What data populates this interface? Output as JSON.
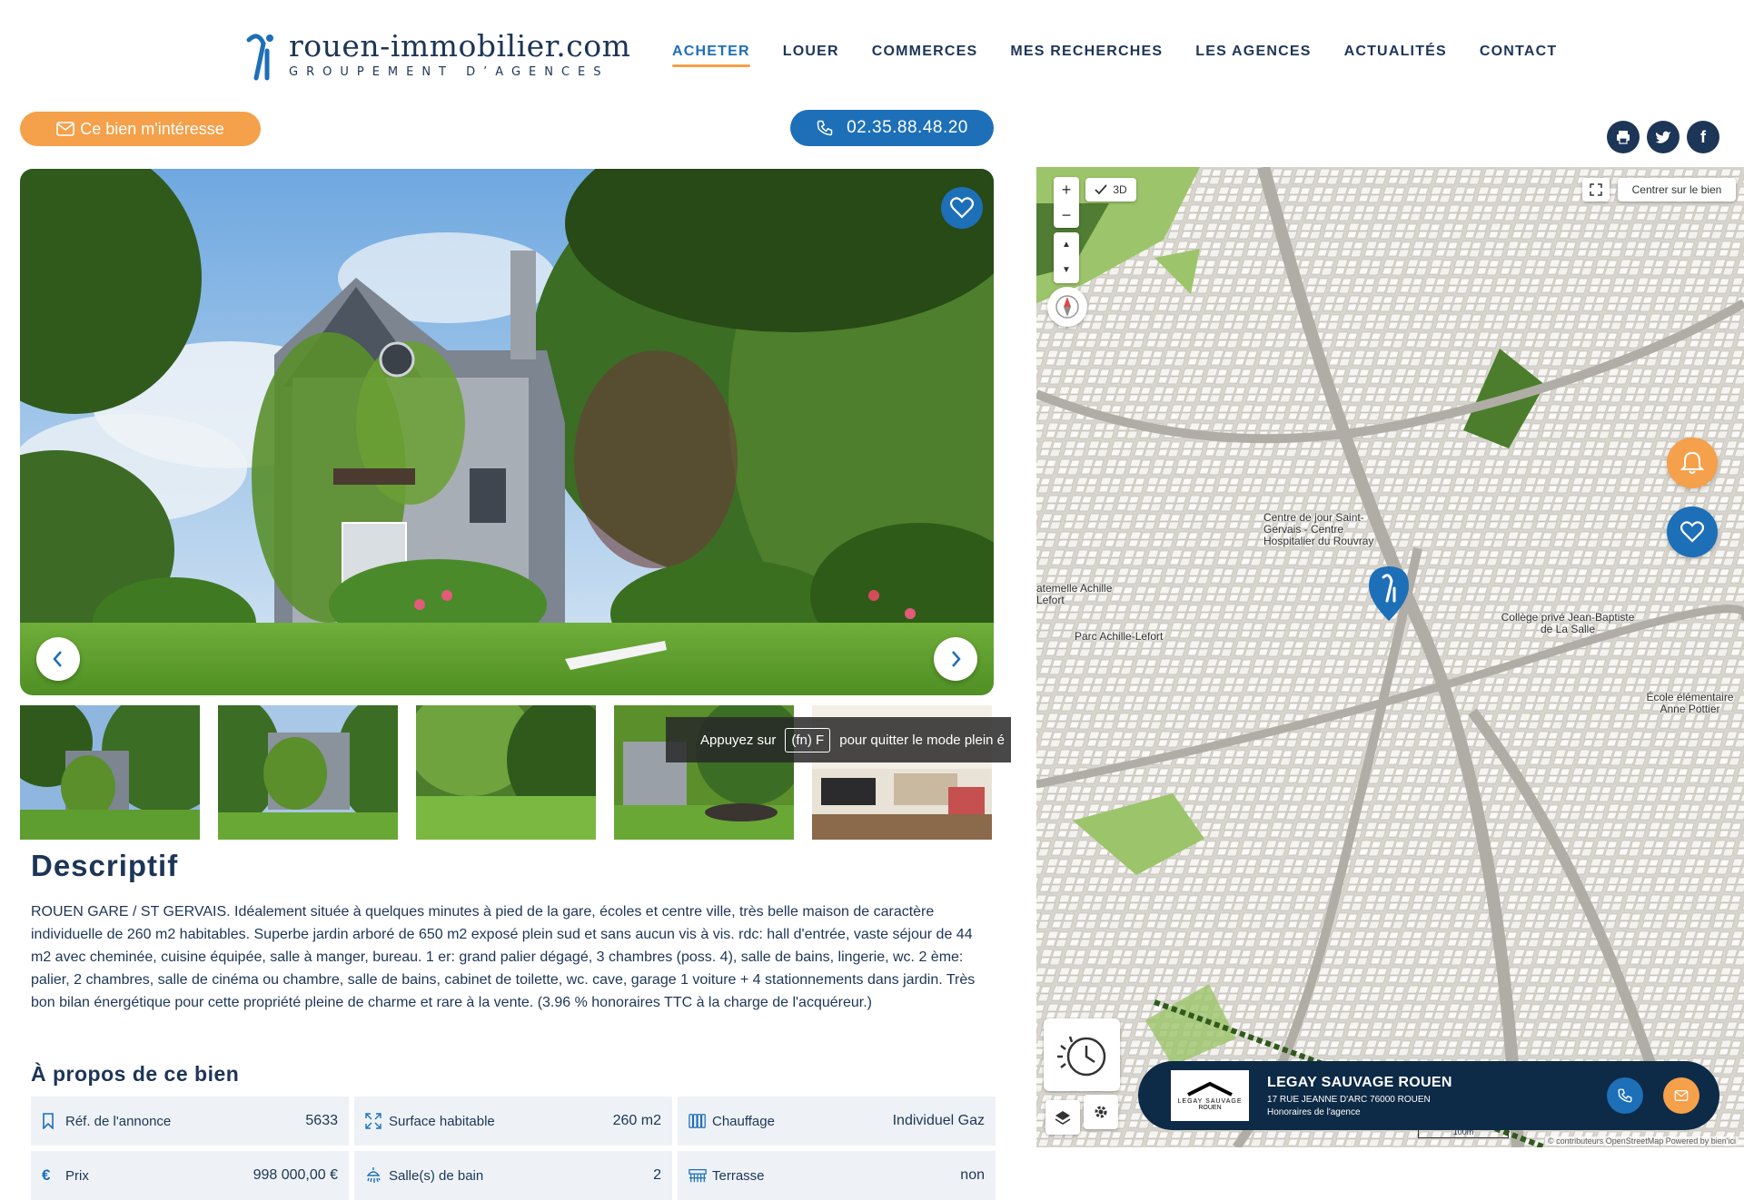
{
  "header": {
    "logo_brand": "rouen-immobilier.com",
    "logo_sub": "GROUPEMENT D’AGENCES",
    "nav": [
      {
        "label": "ACHETER",
        "active": true
      },
      {
        "label": "LOUER"
      },
      {
        "label": "COMMERCES"
      },
      {
        "label": "MES RECHERCHES"
      },
      {
        "label": "LES AGENCES"
      },
      {
        "label": "ACTUALITÉS"
      },
      {
        "label": "CONTACT"
      }
    ]
  },
  "actions": {
    "interest_label": "Ce bien m'intéresse",
    "phone_label": "02.35.88.48.20",
    "social": [
      "print-icon",
      "twitter-icon",
      "facebook-icon"
    ]
  },
  "gallery": {
    "thumbnail_count": 5,
    "tooltip": {
      "prefix": "Appuyez sur",
      "key": "(fn) F",
      "suffix": "pour quitter le mode plein é"
    }
  },
  "description": {
    "title": "Descriptif",
    "text": "ROUEN GARE / ST GERVAIS. Idéalement située à quelques minutes à pied de la gare, écoles et centre ville, très belle maison de caractère individuelle de 260 m2 habitables. Superbe jardin arboré de 650 m2 exposé plein sud et sans aucun vis à vis. rdc: hall d'entrée, vaste séjour de 44 m2 avec cheminée, cuisine équipée, salle à manger, bureau. 1 er: grand palier dégagé, 3 chambres (poss. 4), salle de bains, lingerie, wc. 2 ème: palier, 2 chambres, salle de cinéma ou chambre, salle de bains, cabinet de toilette, wc. cave, garage 1 voiture + 4 stationnements dans jardin. Très bon bilan énergétique pour cette propriété pleine de charme et rare à la vente. (3.96 % honoraires TTC à la charge de l'acquéreur.)"
  },
  "about": {
    "title": "À propos de ce bien",
    "facts": [
      {
        "icon": "bookmark-icon",
        "label": "Réf. de l'annonce",
        "value": "5633"
      },
      {
        "icon": "expand-icon",
        "label": "Surface habitable",
        "value": "260 m2"
      },
      {
        "icon": "radiator-icon",
        "label": "Chauffage",
        "value": "Individuel Gaz"
      },
      {
        "icon": "euro-icon",
        "label": "Prix",
        "value": "998 000,00 €"
      },
      {
        "icon": "shower-icon",
        "label": "Salle(s) de bain",
        "value": "2"
      },
      {
        "icon": "terrace-icon",
        "label": "Terrasse",
        "value": "non"
      }
    ]
  },
  "map": {
    "toggle_3d": "3D",
    "center_label": "Centrer sur le bien",
    "labels": [
      "Centre de jour Saint-Gervais - Centre Hospitalier du Rouvray",
      "Collège privé Jean-Baptiste de La Salle",
      "Parc Achille-Lefort",
      "atemelle Achille Lefort",
      "École élémentaire Anne Pottier"
    ],
    "scale": "100m",
    "attribution": "© contributeurs OpenStreetMap   Powered by bien'ici",
    "agency": {
      "name": "LEGAY SAUVAGE ROUEN",
      "address": "17 RUE JEANNE D'ARC 76000 ROUEN",
      "fee": "Honoraires de l'agence",
      "logo_text": "LEGAY SAUVAGE",
      "logo_sub": "ROUEN"
    }
  },
  "colors": {
    "primary": "#1d6fb8",
    "accent": "#f5a04a",
    "navy": "#1d3557"
  }
}
